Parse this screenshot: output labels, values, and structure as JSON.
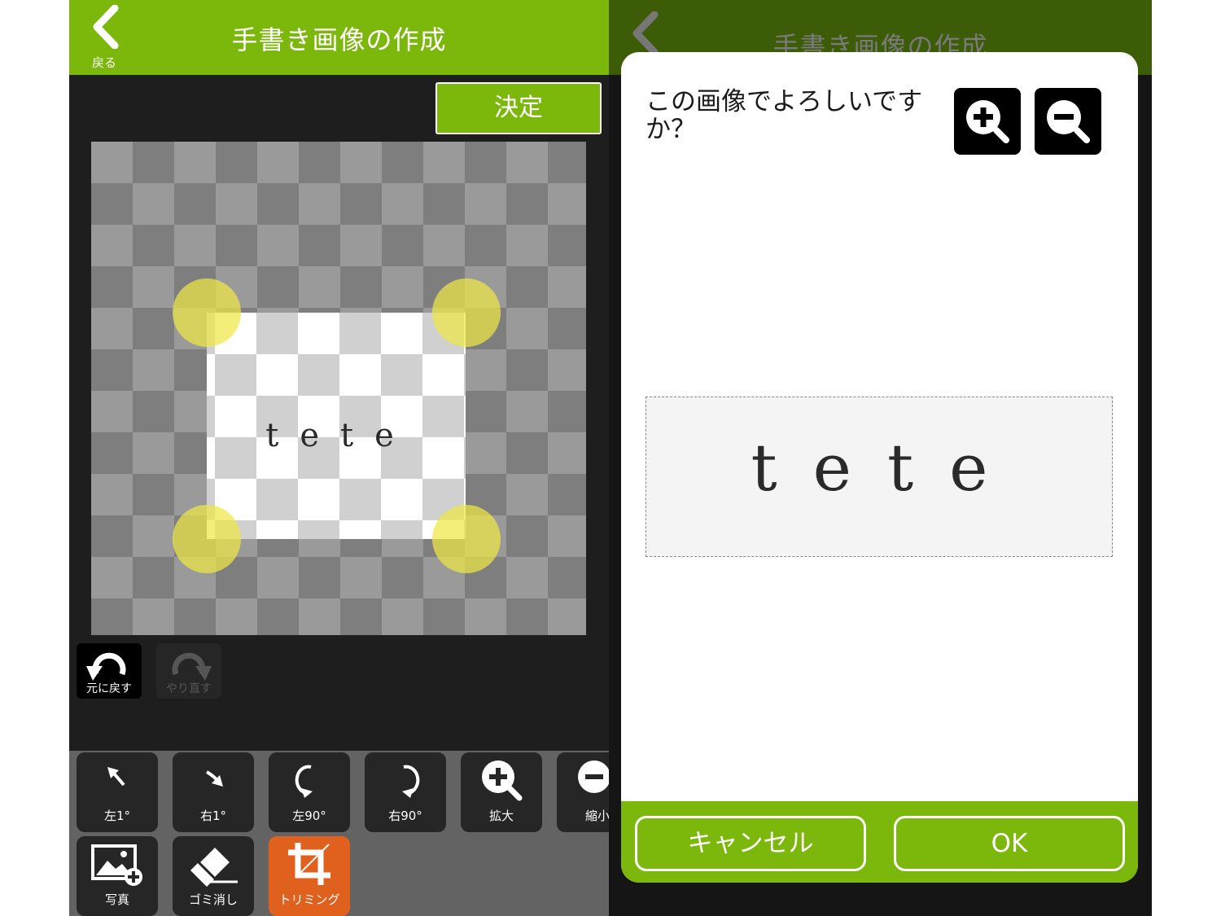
{
  "left": {
    "header": {
      "back_label": "戻る",
      "title": "手書き画像の作成"
    },
    "decide_label": "決定",
    "canvas": {
      "crop_text": "tete"
    },
    "history": {
      "undo_label": "元に戻す",
      "redo_label": "やり直す"
    },
    "tools_row1": [
      {
        "label": "左1°",
        "icon": "rotate-left-small-icon"
      },
      {
        "label": "右1°",
        "icon": "rotate-right-small-icon"
      },
      {
        "label": "左90°",
        "icon": "rotate-left-90-icon"
      },
      {
        "label": "右90°",
        "icon": "rotate-right-90-icon"
      },
      {
        "label": "拡大",
        "icon": "zoom-in-icon"
      },
      {
        "label": "縮小",
        "icon": "zoom-out-icon"
      }
    ],
    "tools_row2": [
      {
        "label": "写真",
        "icon": "add-photo-icon"
      },
      {
        "label": "ゴミ消し",
        "icon": "eraser-icon"
      },
      {
        "label": "トリミング",
        "icon": "crop-icon",
        "active": true
      }
    ]
  },
  "right": {
    "header": {
      "title": "手書き画像の作成"
    },
    "dialog": {
      "question": "この画像でよろしいですか？",
      "preview_text": "tete",
      "cancel_label": "キャンセル",
      "ok_label": "OK"
    }
  },
  "colors": {
    "accent_green": "#7cb70c",
    "active_orange": "#e0601e",
    "handle_yellow": "#eee646"
  }
}
